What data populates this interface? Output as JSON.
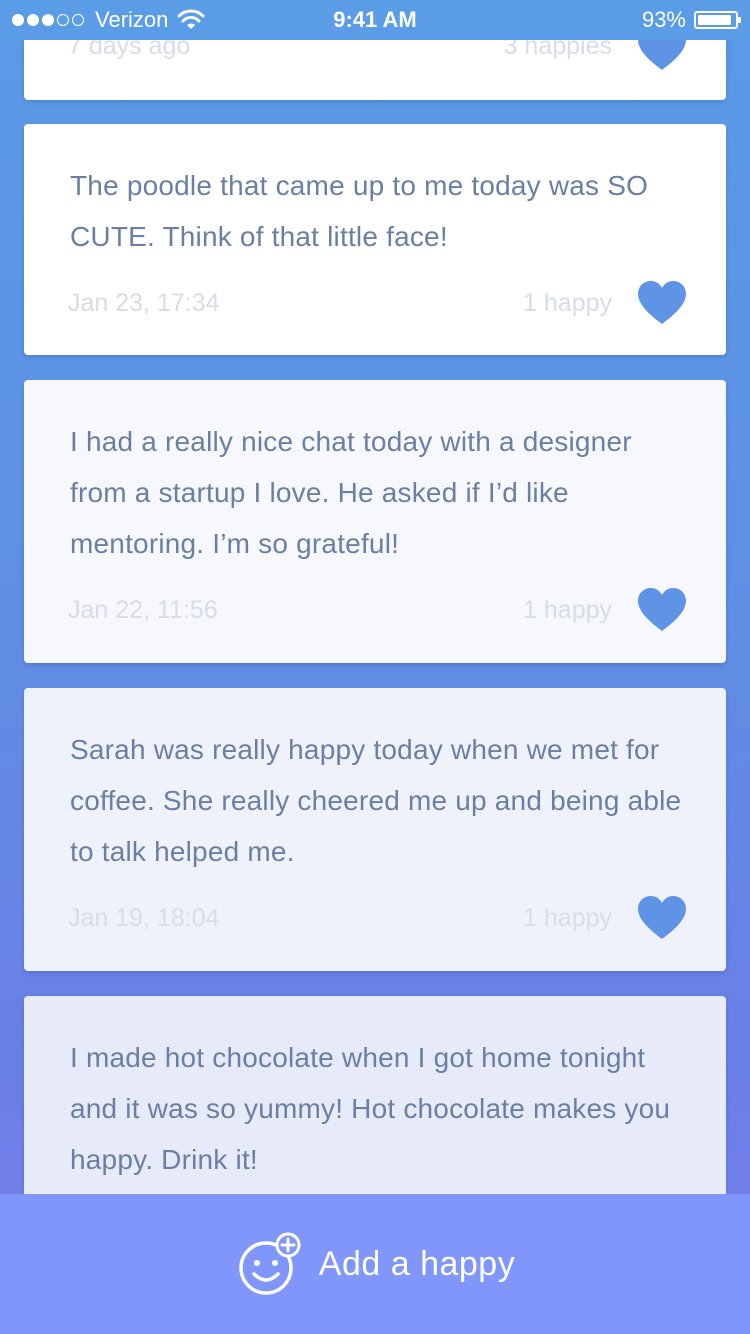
{
  "status_bar": {
    "carrier": "Verizon",
    "time": "9:41 AM",
    "battery_percent": "93%",
    "battery_level": 0.93,
    "signal_bars_filled": 3,
    "signal_bars_total": 5
  },
  "feed": {
    "entries": [
      {
        "text": "",
        "date": "7 days ago",
        "count": "3 happies",
        "background": "#ffffff"
      },
      {
        "text": "The poodle that came up to me today was SO CUTE. Think of that little face!",
        "date": "Jan 23, 17:34",
        "count": "1 happy",
        "background": "#ffffff"
      },
      {
        "text": "I had a really nice chat today with a designer from a startup I love. He asked if I’d like mentoring. I’m so grateful!",
        "date": "Jan 22, 11:56",
        "count": "1 happy",
        "background": "#f6f8fd"
      },
      {
        "text": "Sarah was really happy today when we met for coffee. She really cheered me up and being able to talk helped me.",
        "date": "Jan 19, 18:04",
        "count": "1 happy",
        "background": "#eff2fb"
      },
      {
        "text": "I made hot chocolate when I got home tonight and it was so yummy! Hot chocolate makes you happy. Drink it!",
        "date": "",
        "count": "",
        "background": "#e7eaf8"
      }
    ]
  },
  "bottom_bar": {
    "add_label": "Add a happy",
    "icon": "smiley-plus-icon",
    "background": "#8096fb"
  },
  "colors": {
    "heart": "#5f93e6",
    "text": "#6a7fa3",
    "meta": "#d7dce6"
  }
}
